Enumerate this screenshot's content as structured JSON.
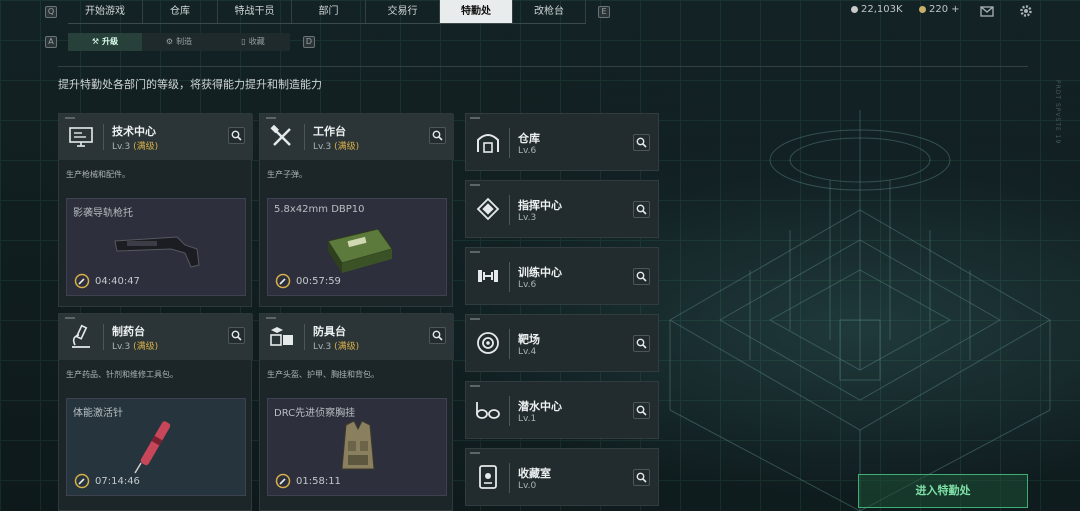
{
  "top_nav": {
    "hint_left": "Q",
    "hint_right": "E",
    "tabs": [
      {
        "label": "开始游戏"
      },
      {
        "label": "仓库"
      },
      {
        "label": "特战干员"
      },
      {
        "label": "部门"
      },
      {
        "label": "交易行"
      },
      {
        "label": "特勤处",
        "active": true
      },
      {
        "label": "改枪台"
      }
    ],
    "currency_silver": "22,103K",
    "currency_gold": "220",
    "add_symbol": "+",
    "icons": [
      "mail-icon",
      "gear-icon"
    ]
  },
  "sub_nav": {
    "hint_left": "A",
    "hint_right": "D",
    "tabs": [
      {
        "label": "升级",
        "icon": "upgrade-icon",
        "active": true
      },
      {
        "label": "制造",
        "icon": "craft-icon"
      },
      {
        "label": "收藏",
        "icon": "collection-icon"
      }
    ]
  },
  "description": "提升特勤处各部门的等级，将获得能力提升和制造能力",
  "workshops": [
    {
      "title": "技术中心",
      "level": "Lv.3",
      "max": "(满级)",
      "icon": "monitor-icon",
      "note": "生产枪械和配件。",
      "product": "影袭导轨枪托",
      "time": "04:40:47",
      "product_icon": "stock-icon"
    },
    {
      "title": "工作台",
      "level": "Lv.3",
      "max": "(满级)",
      "icon": "tools-icon",
      "note": "生产子弹。",
      "product": "5.8x42mm DBP10",
      "time": "00:57:59",
      "product_icon": "ammo-box-icon"
    },
    {
      "title": "制药台",
      "level": "Lv.3",
      "max": "(满级)",
      "icon": "microscope-icon",
      "note": "生产药品、针剂和维修工具包。",
      "product": "体能激活针",
      "time": "07:14:46",
      "product_icon": "syringe-icon"
    },
    {
      "title": "防具台",
      "level": "Lv.3",
      "max": "(满级)",
      "icon": "boxes-icon",
      "note": "生产头盔、护甲、胸挂和背包。",
      "product": "DRC先进侦察胸挂",
      "time": "01:58:11",
      "product_icon": "vest-icon"
    }
  ],
  "facilities": [
    {
      "title": "仓库",
      "level": "Lv.6",
      "icon": "warehouse-icon"
    },
    {
      "title": "指挥中心",
      "level": "Lv.3",
      "icon": "chip-icon"
    },
    {
      "title": "训练中心",
      "level": "Lv.6",
      "icon": "dumbbell-icon"
    },
    {
      "title": "靶场",
      "level": "Lv.4",
      "icon": "target-icon"
    },
    {
      "title": "潜水中心",
      "level": "Lv.1",
      "icon": "goggles-icon"
    },
    {
      "title": "收藏室",
      "level": "Lv.0",
      "icon": "trophy-case-icon"
    }
  ],
  "enter_button": "进入特勤处",
  "side_text": "PRDT SPVSTE 19",
  "colors": {
    "accent_green": "#3fae74",
    "max_level": "#d7b04a",
    "active_tab": "#e9ecec"
  }
}
